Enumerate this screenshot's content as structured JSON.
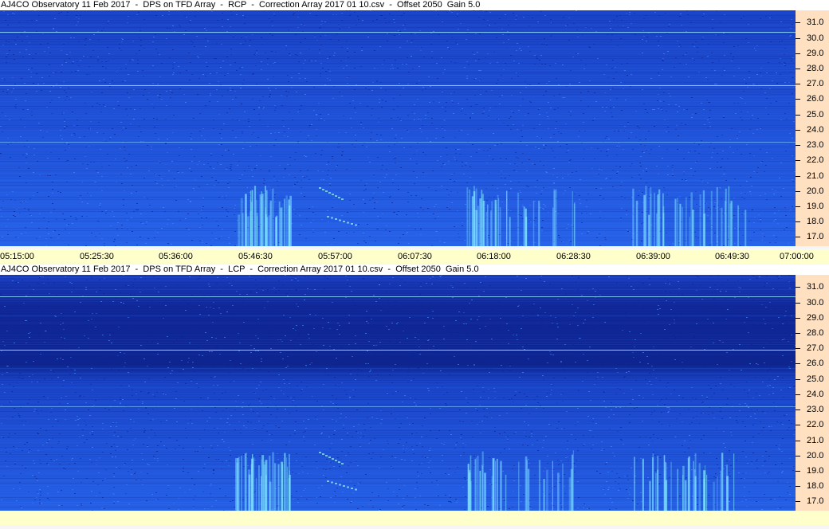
{
  "chart_data": [
    {
      "type": "heatmap",
      "title": "AJ4CO Observatory 11 Feb 2017  -  DPS on TFD Array  -  RCP  -  Correction Array 2017 01 10.csv  -  Offset 2050  Gain 5.0",
      "polarization": "RCP",
      "y_ticks": [
        "31.0",
        "30.0",
        "29.0",
        "28.0",
        "27.0",
        "26.0",
        "25.0",
        "24.0",
        "23.0",
        "22.0",
        "21.0",
        "20.0",
        "19.0",
        "18.0",
        "17.0"
      ],
      "ylim": [
        16.4,
        31.8
      ],
      "x_ticks": [
        "05:15:00",
        "05:25:30",
        "05:36:00",
        "05:46:30",
        "05:57:00",
        "06:07:30",
        "06:18:00",
        "06:28:30",
        "06:39:00",
        "06:49:30",
        "07:00:00"
      ]
    },
    {
      "type": "heatmap",
      "title": "AJ4CO Observatory 11 Feb 2017  -  DPS on TFD Array  -  LCP  -  Correction Array 2017 01 10.csv  -  Offset 2050  Gain 5.0",
      "polarization": "LCP",
      "y_ticks": [
        "31.0",
        "30.0",
        "29.0",
        "28.0",
        "27.0",
        "26.0",
        "25.0",
        "24.0",
        "23.0",
        "22.0",
        "21.0",
        "20.0",
        "19.0",
        "18.0",
        "17.0"
      ],
      "ylim": [
        16.4,
        31.8
      ]
    }
  ],
  "colors": {
    "background": "#1f52d8",
    "dark_band": "#0f2a9a",
    "burst": "#9af0ff",
    "axis_panel": "#ffe0c0",
    "time_panel": "#ffffcc"
  }
}
